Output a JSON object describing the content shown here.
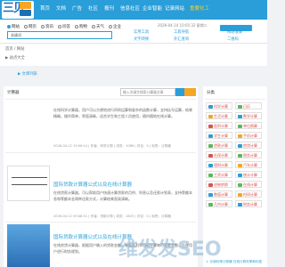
{
  "header": {
    "logo_text": "三贝",
    "nav": [
      "首页",
      "文档",
      "广告",
      "社区",
      "报刊",
      "信息社区",
      "企业智能",
      "记录网站",
      "重要化工"
    ]
  },
  "search": {
    "radio_options": [
      "网站",
      "网页",
      "资讯",
      "问答",
      "购物",
      "天气",
      "企业"
    ],
    "value": "关键词",
    "date": "2026-04-14 10:05:32 星期二",
    "tools": [
      "实用工具",
      "工具导航",
      "网站收录",
      "文字转换",
      "外汇查询",
      "二维码"
    ]
  },
  "breadcrumb": {
    "home": "首页 / 网站",
    "section": "▶ 站点大全",
    "link": "▶ 文章列表"
  },
  "main": {
    "title": "计算器",
    "search_placeholder": "输入关键字搜索计算器文章",
    "search_btn": "搜索",
    "articles": [
      {
        "text": "在线科学计算器，用户可以方便地进行四则运算和复杂的函数计算，支持括号运算，结果精确，操作简单，界面清晰，适合学生和工程人员使用，随时随地在线计算。",
        "meta": "2026-04-12 15:06:14 | 作者：科学计算 | 浏览：1086 | 评论：0 | 标签：计算器"
      },
      {
        "title": "国际贷款计算器公式以及在线计算器",
        "text": "在线贷款计算器，可以帮助用户快速计算贷款的月供、利息以及还款计划表，支持等额本息和等额本金两种还款方式，计算结果直观清晰。",
        "meta": "2026-04-12 09:48:51 | 作者：贷款计算 | 浏览：1625 | 评论：0 | 标签：计算器"
      },
      {
        "title": "国际贷款计算器公式以及在线计算器",
        "text": "在线房贷计算器，根据用户输入的贷款金额、年限及利率自动计算每月还款金额，方便用户进行财务规划。"
      }
    ]
  },
  "sidebar": {
    "title": "分类",
    "tags": [
      "科学计算",
      "日历",
      "生活计算",
      "数学计算",
      "面积计算",
      "单位换算",
      "学生计算",
      "手机计算",
      "贷款计算",
      "房贷计算",
      "社保计算",
      "税务计算",
      "理财计算",
      "汽车计算",
      "工资计算",
      "统计计算",
      "进制转换",
      "在线计算",
      "数值计算",
      "时间计算",
      "几何计算",
      "财务计算"
    ],
    "footer": "1. 长城利率计算器 在线计算利率和利息"
  },
  "watermark": "维发发SEO",
  "colors": {
    "brand": "#2a9ed8",
    "accent": "#f5a623",
    "tag_text": "#d9534f"
  }
}
